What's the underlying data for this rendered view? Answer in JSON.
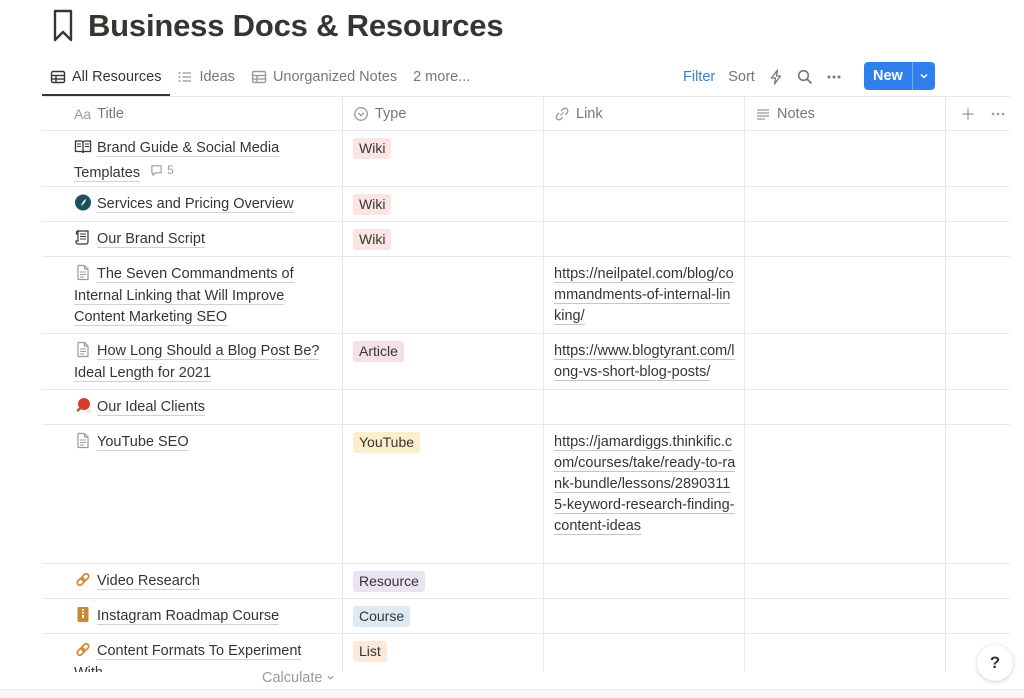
{
  "page": {
    "title": "Business Docs & Resources"
  },
  "views": [
    {
      "label": "All Resources",
      "icon": "table-icon",
      "active": true
    },
    {
      "label": "Ideas",
      "icon": "list-icon"
    },
    {
      "label": "Unorganized Notes",
      "icon": "table-icon"
    },
    {
      "label": "2 more..."
    }
  ],
  "toolbar": {
    "filter": "Filter",
    "sort": "Sort",
    "new": "New"
  },
  "columns": {
    "title": "Title",
    "title_prefix": "Aa",
    "type": "Type",
    "link": "Link",
    "notes": "Notes"
  },
  "tag_colors": {
    "Wiki": "#fbe4e4",
    "Article": "#f4dfeb",
    "YouTube": "#fbeecc",
    "Resource": "#eae4f2",
    "Course": "#dbeaf4",
    "List": "#fbe9dc"
  },
  "rows": [
    {
      "title": "Brand Guide & Social Media Templates",
      "icon": "book-icon",
      "comments": "5",
      "type": "Wiki",
      "link": ""
    },
    {
      "title": "Services and Pricing Overview",
      "icon": "feather-icon",
      "type": "Wiki",
      "link": ""
    },
    {
      "title": "Our Brand Script",
      "icon": "scroll-icon",
      "type": "Wiki",
      "link": ""
    },
    {
      "title": "The Seven Commandments of Internal Linking that Will Improve Content Marketing SEO",
      "icon": "page-icon",
      "type": "",
      "link": "https://neilpatel.com/blog/commandments-of-internal-linking/"
    },
    {
      "title": "How Long Should a Blog Post Be? Ideal Length for 2021",
      "icon": "page-icon",
      "type": "Article",
      "link": "https://www.blogtyrant.com/long-vs-short-blog-posts/"
    },
    {
      "title": "Our Ideal Clients",
      "icon": "ping-pong-icon",
      "type": "",
      "link": ""
    },
    {
      "title": "YouTube SEO",
      "icon": "page-icon",
      "type": "YouTube",
      "link": "https://jamardiggs.thinkific.com/courses/take/ready-to-rank-bundle/lessons/28903115-keyword-research-finding-content-ideas"
    },
    {
      "title": "Video Research",
      "icon": "link-icon",
      "type": "Resource",
      "link": ""
    },
    {
      "title": "Instagram Roadmap Course",
      "icon": "zip-file-icon",
      "type": "Course",
      "link": ""
    },
    {
      "title": "Content Formats To Experiment With",
      "icon": "link-icon",
      "type": "List",
      "link": ""
    }
  ],
  "footer": {
    "calculate": "Calculate"
  },
  "help": {
    "label": "?"
  }
}
